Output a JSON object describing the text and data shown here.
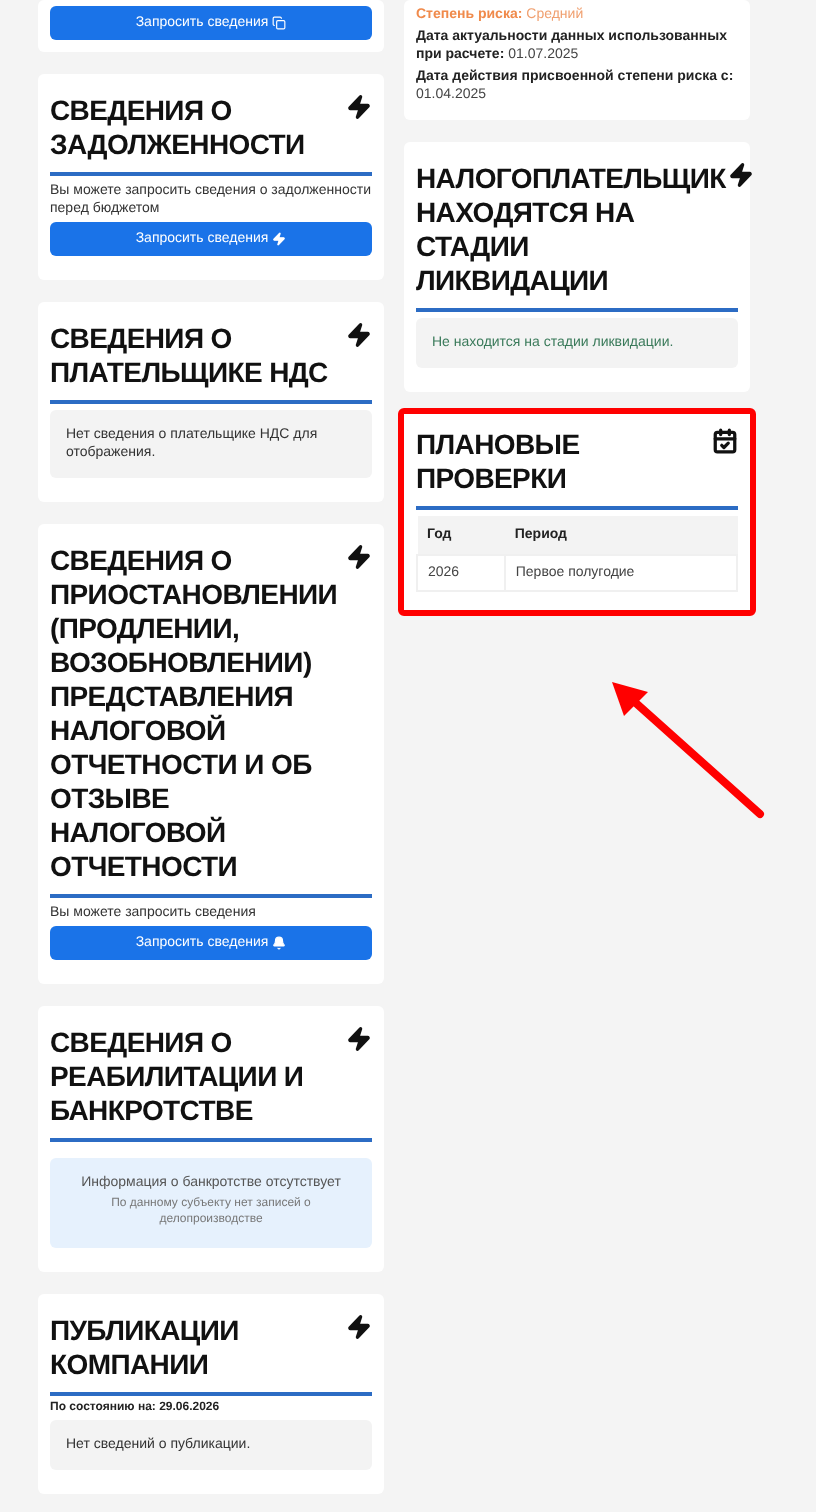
{
  "left_column": [
    {
      "items": [
        {
          "kind": "button",
          "label": "Запросить сведения"
        }
      ]
    },
    {
      "title": "СВЕДЕНИЯ О ЗАДОЛЖЕННОСТИ",
      "items": [
        {
          "kind": "note",
          "text": "Вы можете запросить сведения о задолженности перед бюджетом"
        },
        {
          "kind": "button",
          "label": "Запросить сведения"
        }
      ]
    },
    {
      "title": "СВЕДЕНИЯ О ПЛАТЕЛЬЩИКЕ НДС",
      "items": [
        {
          "kind": "info",
          "text": "Нет сведения о плательщике НДС для отображения."
        }
      ]
    },
    {
      "title": "СВЕДЕНИЯ О ПРИОСТАНОВЛЕНИИ (ПРОДЛЕНИИ, ВОЗОБНОВЛЕНИИ) ПРЕДСТАВЛЕНИЯ НАЛОГОВОЙ ОТЧЕТНОСТИ И ОБ ОТЗЫВЕ НАЛОГОВОЙ ОТЧЕТНОСТИ",
      "items": [
        {
          "kind": "note",
          "text": "Вы можете запросить сведения"
        },
        {
          "kind": "button",
          "label": "Запросить сведения"
        }
      ]
    },
    {
      "title": "СВЕДЕНИЯ О РЕАБИЛИТАЦИИ И БАНКРОТСТВЕ",
      "items": [
        {
          "kind": "notice",
          "heading": "Информация о банкротстве отсутствует",
          "text": "По данному субъекту нет записей о делопроизводстве"
        }
      ]
    },
    {
      "title": "ПУБЛИКАЦИИ КОМПАНИИ",
      "items": [
        {
          "kind": "stamp",
          "text": "По состоянию на: 29.06.2026"
        },
        {
          "kind": "info",
          "text": "Нет сведений о публикации."
        }
      ]
    }
  ],
  "right_column": [
    {
      "items": [
        {
          "kind": "risk",
          "label": "Степень риска:",
          "value": "Средний"
        },
        {
          "kind": "fact",
          "label": "Дата актуальности данных использованных при расчете:",
          "value": "01.07.2025"
        },
        {
          "kind": "fact",
          "label": "Дата действия присвоенной степени риска с:",
          "value": "01.04.2025"
        }
      ]
    },
    {
      "title": "НАЛОГОПЛАТЕЛЬЩИК НАХОДЯТСЯ НА СТАДИИ ЛИКВИДАЦИИ",
      "items": [
        {
          "kind": "status",
          "text": "Не находится на стадии ликвидации."
        }
      ]
    },
    {
      "title": "ПЛАНОВЫЕ ПРОВЕРКИ",
      "highlighted": true,
      "items": [
        {
          "kind": "table",
          "columns": [
            "Год",
            "Период"
          ],
          "rows": [
            [
              "2026",
              "Первое полугодие"
            ]
          ]
        }
      ]
    }
  ]
}
